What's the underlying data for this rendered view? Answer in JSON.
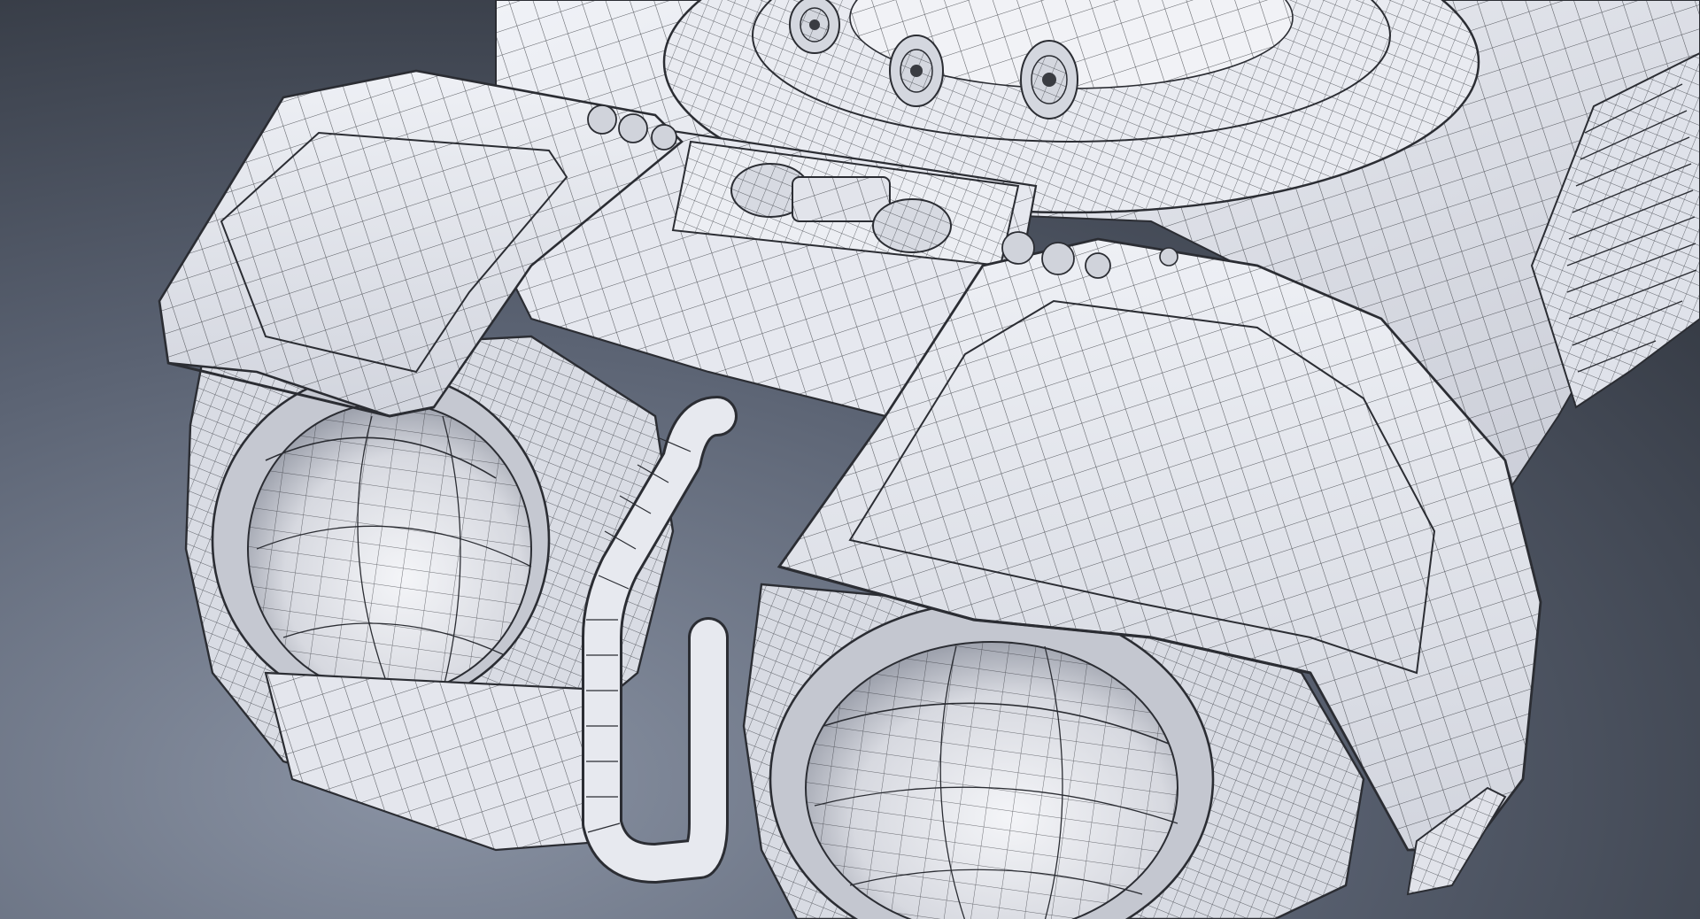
{
  "scene": {
    "subject": "wireframe-render",
    "colors": {
      "background_top": "#2c3038",
      "background_mid": "#505866",
      "background_bottom": "#7a8496",
      "model_fill": "#e3e6ee",
      "model_shade": "#b9bdc8",
      "model_dark": "#8e929e",
      "wire": "#2b2d33"
    }
  }
}
